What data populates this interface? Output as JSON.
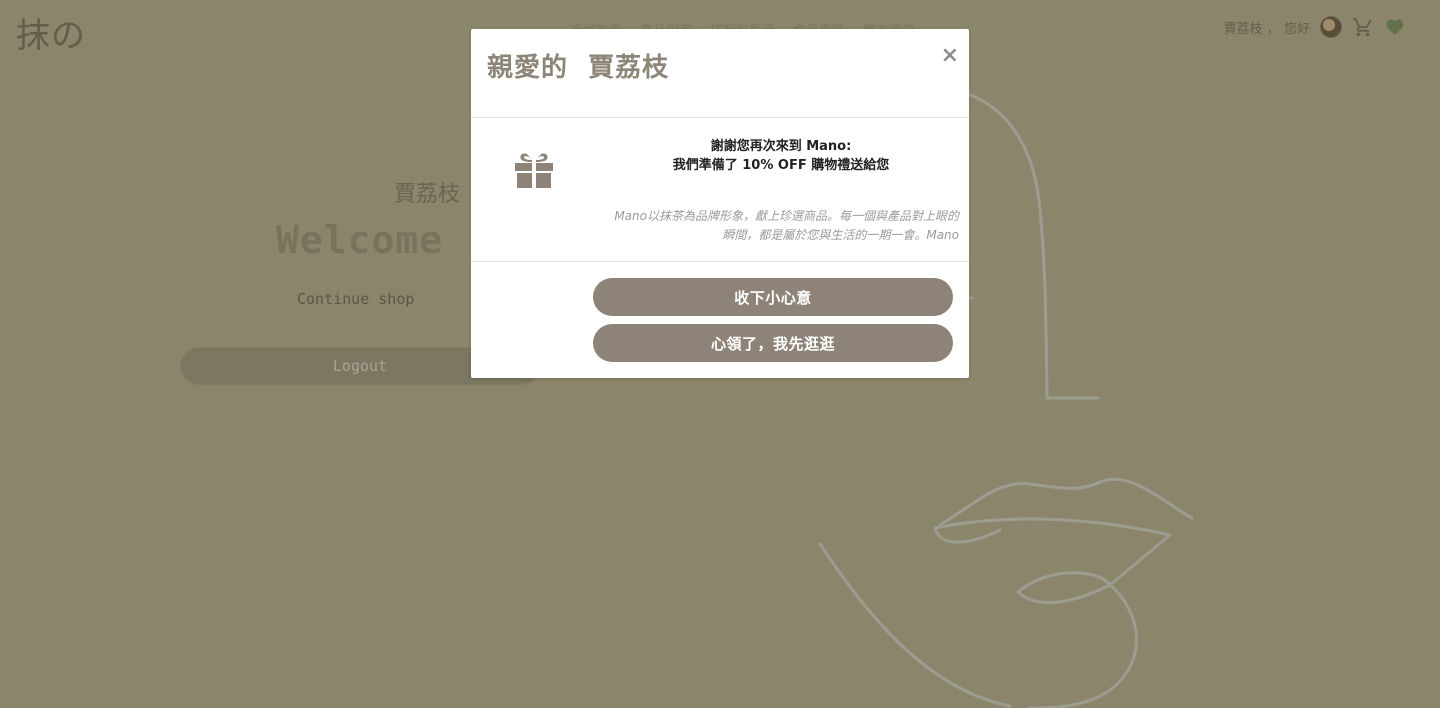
{
  "site": {
    "logo": "抹の",
    "nav": [
      "商城首頁",
      "產品列表",
      "搭配好生活",
      "會員專區",
      "門市資訊"
    ],
    "greeting_name": "賈荔枝",
    "greeting_sep": "，",
    "greeting_hello": "您好",
    "icons": {
      "avatar": "avatar",
      "cart": "cart-icon",
      "wishlist": "heart-icon"
    },
    "accent": "#7e9a66"
  },
  "main": {
    "user_name": "賈荔枝",
    "welcome": "Welcome",
    "continue_shop": "Continue shop",
    "logout": "Logout"
  },
  "modal": {
    "title": "親愛的  賈荔枝",
    "close": "×",
    "gift_icon": "gift-icon",
    "greeting_line1": "謝謝您再次來到 Mano:",
    "greeting_line2": "我們準備了 10% OFF 購物禮送給您",
    "description": "Mano以抹茶為品牌形象，獻上珍選商品。每一個與產品對上眼的瞬間，都是屬於您與生活的一期一會。Mano",
    "accept_button": "收下小心意",
    "later_button": "心領了，我先逛逛"
  }
}
